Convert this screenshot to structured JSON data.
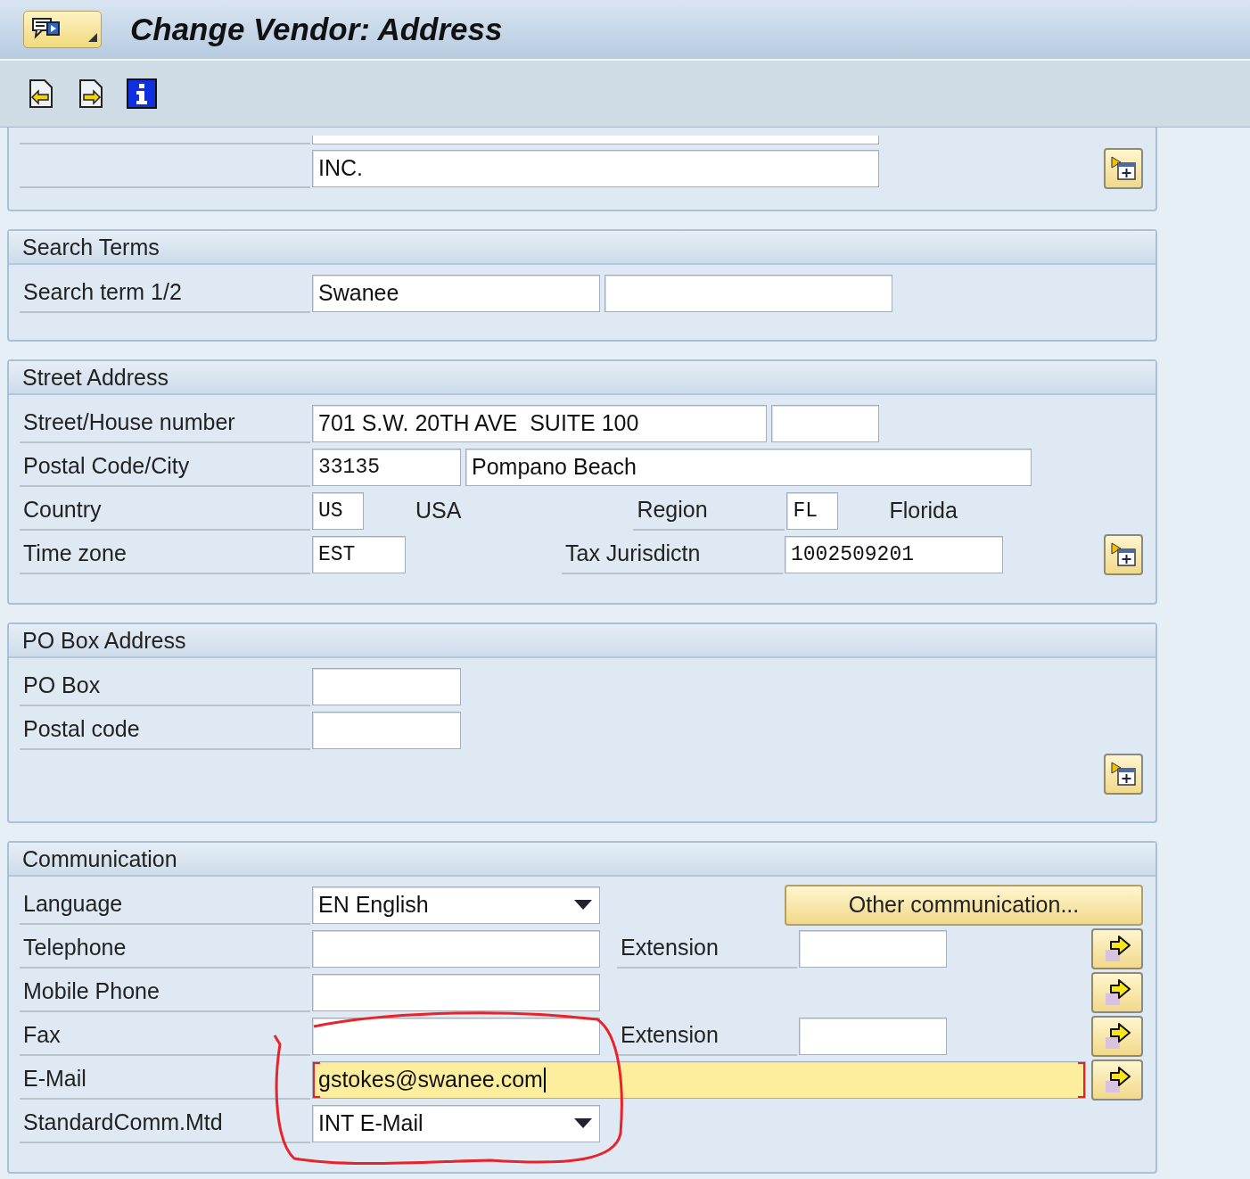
{
  "title_bar": {
    "title": "Change Vendor: Address"
  },
  "name_section": {
    "name_4": "INC."
  },
  "search_terms": {
    "title": "Search Terms",
    "label": "Search term 1/2",
    "term_1": "Swanee"
  },
  "street_address": {
    "title": "Street Address",
    "street_label": "Street/House number",
    "street": "701 S.W. 20TH AVE  SUITE 100",
    "postal_label": "Postal Code/City",
    "postal_code": "33135",
    "city": "Pompano Beach",
    "country_label": "Country",
    "country_code": "US",
    "country_name": "USA",
    "region_label": "Region",
    "region_code": "FL",
    "region_name": "Florida",
    "time_zone_label": "Time zone",
    "time_zone": "EST",
    "tax_label": "Tax Jurisdictn",
    "tax_jurisdiction": "1002509201"
  },
  "po_box_address": {
    "title": "PO Box Address",
    "po_box_label": "PO Box",
    "postal_code_label": "Postal code"
  },
  "communication": {
    "title": "Communication",
    "language_label": "Language",
    "language": "EN English",
    "other_button": "Other communication...",
    "telephone_label": "Telephone",
    "telephone_extension_label": "Extension",
    "mobile_label": "Mobile Phone",
    "fax_label": "Fax",
    "fax_extension_label": "Extension",
    "email_label": "E-Mail",
    "email": "gstokes@swanee.com",
    "email_focused": true,
    "standard_label": "StandardComm.Mtd",
    "standard_method": "INT E-Mail"
  }
}
